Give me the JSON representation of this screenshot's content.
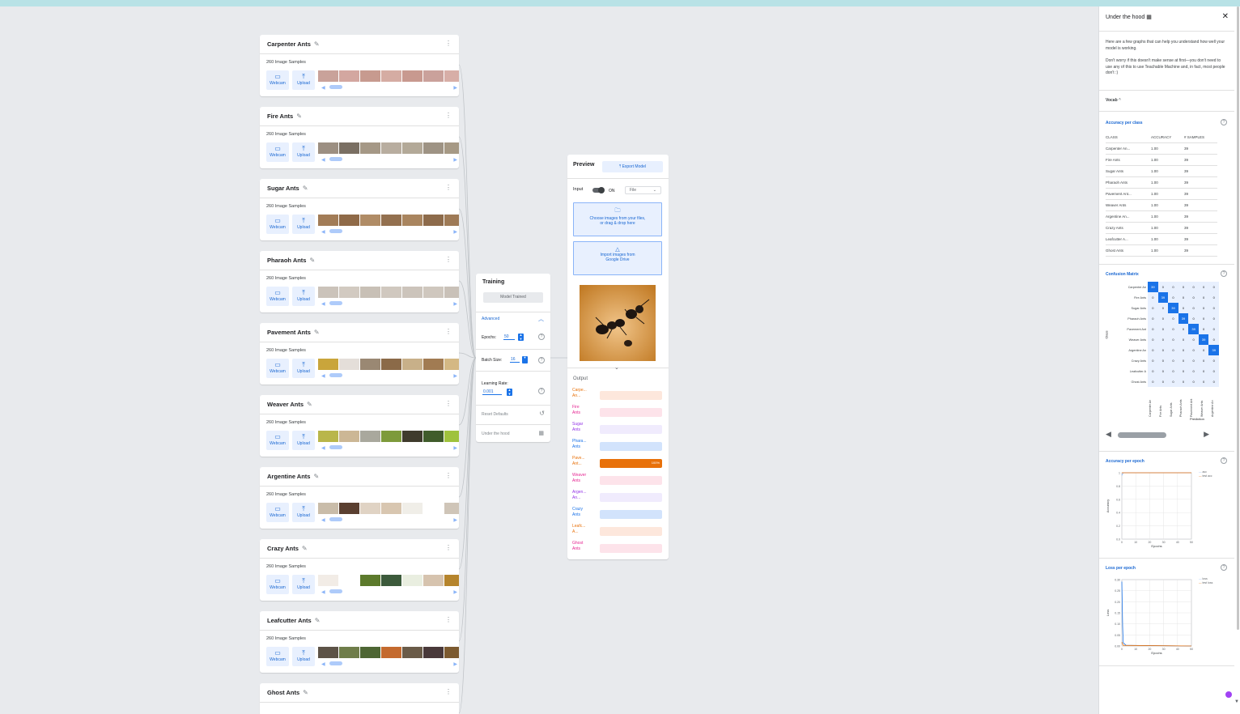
{
  "classes": [
    {
      "name": "Carpenter Ants",
      "samples": "260 Image Samples",
      "thumbs": [
        "#c9a29a",
        "#d3a7a0",
        "#c79a8f",
        "#d5aca3",
        "#c8998f",
        "#caa19b",
        "#d7aea7"
      ]
    },
    {
      "name": "Fire Ants",
      "samples": "260 Image Samples",
      "thumbs": [
        "#9c8f82",
        "#7a6f63",
        "#a59886",
        "#b8ad9f",
        "#b3a998",
        "#9e9384",
        "#a69985"
      ]
    },
    {
      "name": "Sugar Ants",
      "samples": "260 Image Samples",
      "thumbs": [
        "#a27c57",
        "#8f6a48",
        "#b08c66",
        "#93704f",
        "#a9855f",
        "#8d6b4b",
        "#9e7a56"
      ]
    },
    {
      "name": "Pharaoh Ants",
      "samples": "260 Image Samples",
      "thumbs": [
        "#cbc3ba",
        "#d2cac1",
        "#c8c0b6",
        "#d0c8bf",
        "#ccc4bb",
        "#cfc7be",
        "#c9c1b8"
      ]
    },
    {
      "name": "Pavement Ants",
      "samples": "260 Image Samples",
      "thumbs": [
        "#c9a53b",
        "#e4ded9",
        "#9a8873",
        "#8b6a48",
        "#c8b089",
        "#a17b52",
        "#d4b884"
      ]
    },
    {
      "name": "Weaver Ants",
      "samples": "260 Image Samples",
      "thumbs": [
        "#b9b64a",
        "#ccb795",
        "#a9a89d",
        "#7d9a3b",
        "#3f3b2c",
        "#405c2b",
        "#9fc23d"
      ]
    },
    {
      "name": "Argentine Ants",
      "samples": "260 Image Samples",
      "thumbs": [
        "#c9bca9",
        "#5a3f30",
        "#e0d3c4",
        "#d8c6b0",
        "#f0eee8",
        "#ffffff",
        "#cfc5b8"
      ]
    },
    {
      "name": "Crazy Ants",
      "samples": "260 Image Samples",
      "thumbs": [
        "#f2ece6",
        "#ffffff",
        "#5c7a2c",
        "#3c5a3b",
        "#e9eee0",
        "#d6c3ae",
        "#b5842c"
      ]
    },
    {
      "name": "Leafcutter Ants",
      "samples": "260 Image Samples",
      "thumbs": [
        "#5d5347",
        "#6f7d4a",
        "#4e6634",
        "#c46a2e",
        "#6a5b48",
        "#49393a",
        "#7c5a30"
      ]
    }
  ],
  "ghost_class": {
    "name": "Ghost Ants"
  },
  "card_buttons": {
    "webcam": "Webcam",
    "upload": "Upload"
  },
  "training": {
    "title": "Training",
    "model_button": "Model Trained",
    "advanced": "Advanced",
    "epochs_label": "Epochs:",
    "epochs_value": "50",
    "batch_label": "Batch Size:",
    "batch_value": "16",
    "lr_label": "Learning Rate:",
    "lr_value": "0.001",
    "reset": "Reset Defaults",
    "under_hood": "Under the hood"
  },
  "preview": {
    "title": "Preview",
    "export": "Export Model",
    "input_label": "Input",
    "toggle_state": "ON",
    "source": "File",
    "choose_line1": "Choose images from your files,",
    "choose_line2": "or drag & drop here",
    "import_line1": "Import images from",
    "import_line2": "Google Drive",
    "output_title": "Output",
    "outputs": [
      {
        "label1": "Carpe...",
        "label2": "An...",
        "color": "#e8710a",
        "track": "#fde7dc",
        "value": 0
      },
      {
        "label1": "Fire",
        "label2": "Ants",
        "color": "#e52592",
        "track": "#fde3ea",
        "value": 0
      },
      {
        "label1": "Sugar",
        "label2": "Ants",
        "color": "#9334e6",
        "track": "#f0ebfd",
        "value": 0
      },
      {
        "label1": "Phara...",
        "label2": "Ants",
        "color": "#1a73e8",
        "track": "#d2e3fc",
        "value": 0
      },
      {
        "label1": "Pave...",
        "label2": "Ant...",
        "color": "#e8710a",
        "track": "#fde7dc",
        "value": 100,
        "pct": "100%"
      },
      {
        "label1": "Weaver",
        "label2": "Ants",
        "color": "#e52592",
        "track": "#fde3ea",
        "value": 0
      },
      {
        "label1": "Argen...",
        "label2": "An...",
        "color": "#9334e6",
        "track": "#f0ebfd",
        "value": 0
      },
      {
        "label1": "Crazy",
        "label2": "Ants",
        "color": "#1a73e8",
        "track": "#d2e3fc",
        "value": 0
      },
      {
        "label1": "Leafc...",
        "label2": "A...",
        "color": "#e8710a",
        "track": "#fde7dc",
        "value": 0
      },
      {
        "label1": "Ghost",
        "label2": "Ants",
        "color": "#e52592",
        "track": "#fde3ea",
        "value": 0
      }
    ]
  },
  "panel": {
    "title": "Under the hood",
    "intro": "Here are a few graphs that can help you understand how well your model is working.",
    "note": "Don't worry if this doesn't make sense at first—you don't need to use any of this to use Teachable Machine and, in fact, most people don't :)",
    "vocab": "Vocab",
    "acc_title": "Accuracy per class",
    "acc_headers": [
      "CLASS",
      "ACCURACY",
      "# SAMPLES"
    ],
    "acc_rows": [
      [
        "Carpenter An...",
        "1.00",
        "39"
      ],
      [
        "Fire Ants",
        "1.00",
        "39"
      ],
      [
        "Sugar Ants",
        "1.00",
        "39"
      ],
      [
        "Pharaoh Ants",
        "1.00",
        "39"
      ],
      [
        "Pavement Ant...",
        "1.00",
        "39"
      ],
      [
        "Weaver Ants",
        "1.00",
        "39"
      ],
      [
        "Argentine An...",
        "1.00",
        "39"
      ],
      [
        "Crazy Ants",
        "1.00",
        "39"
      ],
      [
        "Leafcutter A...",
        "1.00",
        "39"
      ],
      [
        "Ghost Ants",
        "1.00",
        "39"
      ]
    ],
    "cm_title": "Confusion Matrix",
    "cm_rows": [
      "Carpenter An",
      "Fire Ants",
      "Sugar Ants",
      "Pharaoh Ants",
      "Pavement Ant",
      "Weaver Ants",
      "Argentine An",
      "Crazy Ants",
      "Leafcutter A",
      "Ghost Ants"
    ],
    "cm_cols": [
      "Carpenter An",
      "Fire Ants",
      "Sugar Ants",
      "Pharaoh Ants",
      "Pavement Ant",
      "Weaver Ants",
      "Argentine An"
    ],
    "cm_values": [
      [
        39,
        0,
        0,
        0,
        0,
        0,
        0
      ],
      [
        0,
        39,
        0,
        0,
        0,
        0,
        0
      ],
      [
        0,
        0,
        39,
        0,
        0,
        0,
        0
      ],
      [
        0,
        0,
        0,
        39,
        0,
        0,
        0
      ],
      [
        0,
        0,
        0,
        0,
        39,
        0,
        0
      ],
      [
        0,
        0,
        0,
        0,
        0,
        39,
        0
      ],
      [
        0,
        0,
        0,
        0,
        0,
        0,
        39
      ],
      [
        0,
        0,
        0,
        0,
        0,
        0,
        0
      ],
      [
        0,
        0,
        0,
        0,
        0,
        0,
        0
      ],
      [
        0,
        0,
        0,
        0,
        0,
        0,
        0
      ]
    ],
    "cm_ylabel": "Class",
    "cm_xlabel": "Prediction",
    "acc_epoch_title": "Accuracy per epoch",
    "acc_epoch_ylabel": "Accuracy",
    "acc_epoch_xlabel": "Epochs",
    "acc_epoch_yticks": [
      "1",
      "0.8",
      "0.6",
      "0.4",
      "0.2",
      "0.0"
    ],
    "acc_epoch_xticks": [
      "0",
      "10",
      "20",
      "30",
      "40",
      "50"
    ],
    "acc_legend": [
      "acc",
      "test acc"
    ],
    "loss_title": "Loss per epoch",
    "loss_ylabel": "Loss",
    "loss_xlabel": "Epochs",
    "loss_yticks": [
      "0.30",
      "0.25",
      "0.20",
      "0.15",
      "0.10",
      "0.05",
      "0.00"
    ],
    "loss_xticks": [
      "0",
      "10",
      "20",
      "30",
      "40",
      "50"
    ],
    "loss_legend": [
      "loss",
      "test loss"
    ]
  }
}
